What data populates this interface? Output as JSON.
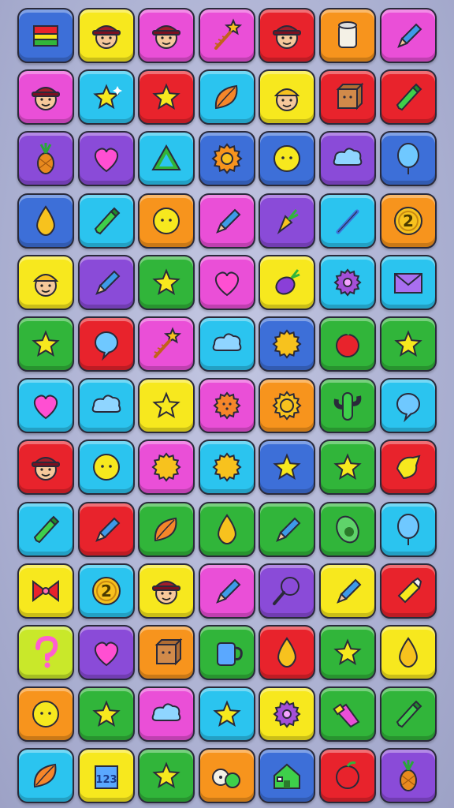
{
  "palette": {
    "red": "#e8232c",
    "yellow": "#f7e81e",
    "magenta": "#ea4fd7",
    "cyan": "#2bc4ef",
    "green": "#31b53a",
    "orange": "#f7941d",
    "purple": "#8a4bd8",
    "blue": "#3d6fd8",
    "lime": "#c9e82a"
  },
  "grid": [
    [
      [
        "blue",
        "gift-icon"
      ],
      [
        "yellow",
        "face-icon"
      ],
      [
        "magenta",
        "face-icon"
      ],
      [
        "magenta",
        "star-wand-icon"
      ],
      [
        "red",
        "face-icon"
      ],
      [
        "orange",
        "jar-icon"
      ],
      [
        "magenta",
        "pencil-icon"
      ]
    ],
    [
      [
        "magenta",
        "face-icon"
      ],
      [
        "cyan",
        "sparkle-star-icon"
      ],
      [
        "red",
        "star-icon"
      ],
      [
        "cyan",
        "leaf-icon"
      ],
      [
        "yellow",
        "face-cap-icon"
      ],
      [
        "red",
        "box-icon"
      ],
      [
        "red",
        "crayon-icon"
      ]
    ],
    [
      [
        "purple",
        "pineapple-icon"
      ],
      [
        "purple",
        "heart-icon"
      ],
      [
        "cyan",
        "triangle-icon"
      ],
      [
        "blue",
        "sunflower-icon"
      ],
      [
        "blue",
        "button-icon"
      ],
      [
        "purple",
        "cloud-icon"
      ],
      [
        "blue",
        "balloon-icon"
      ]
    ],
    [
      [
        "blue",
        "drop-icon"
      ],
      [
        "cyan",
        "crayon-icon"
      ],
      [
        "orange",
        "button-icon"
      ],
      [
        "magenta",
        "pencil-icon"
      ],
      [
        "purple",
        "carrot-icon"
      ],
      [
        "cyan",
        "pen-icon"
      ],
      [
        "orange",
        "coin-icon"
      ]
    ],
    [
      [
        "yellow",
        "face-cap-icon"
      ],
      [
        "purple",
        "pencil-icon"
      ],
      [
        "green",
        "star-icon"
      ],
      [
        "magenta",
        "heart-icon"
      ],
      [
        "yellow",
        "radish-icon"
      ],
      [
        "cyan",
        "flower-icon"
      ],
      [
        "cyan",
        "envelope-icon"
      ]
    ],
    [
      [
        "green",
        "star-icon"
      ],
      [
        "red",
        "bubble-icon"
      ],
      [
        "magenta",
        "star-wand-icon"
      ],
      [
        "cyan",
        "cloud-icon"
      ],
      [
        "blue",
        "burst-icon"
      ],
      [
        "green",
        "apple-icon"
      ],
      [
        "green",
        "star-icon"
      ]
    ],
    [
      [
        "cyan",
        "heart-icon"
      ],
      [
        "cyan",
        "cloud-icon"
      ],
      [
        "yellow",
        "star-icon"
      ],
      [
        "magenta",
        "cookie-icon"
      ],
      [
        "orange",
        "gear-flower-icon"
      ],
      [
        "green",
        "cactus-icon"
      ],
      [
        "cyan",
        "bubble-icon"
      ]
    ],
    [
      [
        "red",
        "face-icon"
      ],
      [
        "cyan",
        "button-icon"
      ],
      [
        "magenta",
        "burst-icon"
      ],
      [
        "cyan",
        "burst-icon"
      ],
      [
        "blue",
        "star-icon"
      ],
      [
        "green",
        "star-icon"
      ],
      [
        "red",
        "plus-icon"
      ]
    ],
    [
      [
        "cyan",
        "crayon-icon"
      ],
      [
        "red",
        "pencil-icon"
      ],
      [
        "green",
        "leaf-icon"
      ],
      [
        "green",
        "drop-icon"
      ],
      [
        "green",
        "pencil-icon"
      ],
      [
        "green",
        "avocado-icon"
      ],
      [
        "cyan",
        "balloon-icon"
      ]
    ],
    [
      [
        "yellow",
        "bow-icon"
      ],
      [
        "cyan",
        "coin-icon"
      ],
      [
        "yellow",
        "face-icon"
      ],
      [
        "magenta",
        "pencil-icon"
      ],
      [
        "purple",
        "racket-icon"
      ],
      [
        "yellow",
        "pencil-icon"
      ],
      [
        "red",
        "glue-icon"
      ]
    ],
    [
      [
        "lime",
        "question-icon"
      ],
      [
        "purple",
        "heart-icon"
      ],
      [
        "orange",
        "box-icon"
      ],
      [
        "green",
        "mug-icon"
      ],
      [
        "red",
        "drop-icon"
      ],
      [
        "green",
        "star-icon"
      ],
      [
        "yellow",
        "drop-icon"
      ]
    ],
    [
      [
        "orange",
        "button-icon"
      ],
      [
        "green",
        "star-icon"
      ],
      [
        "magenta",
        "cloud-icon"
      ],
      [
        "cyan",
        "star-icon"
      ],
      [
        "yellow",
        "flower-icon"
      ],
      [
        "green",
        "marker-icon"
      ],
      [
        "green",
        "crayon-icon"
      ]
    ],
    [
      [
        "cyan",
        "leaf-icon"
      ],
      [
        "yellow",
        "block-icon"
      ],
      [
        "green",
        "star-icon"
      ],
      [
        "orange",
        "dice-icon"
      ],
      [
        "blue",
        "house-icon"
      ],
      [
        "red",
        "apple-icon"
      ],
      [
        "purple",
        "pineapple-icon"
      ]
    ]
  ],
  "labels": {
    "coin": "2",
    "block": "123"
  }
}
